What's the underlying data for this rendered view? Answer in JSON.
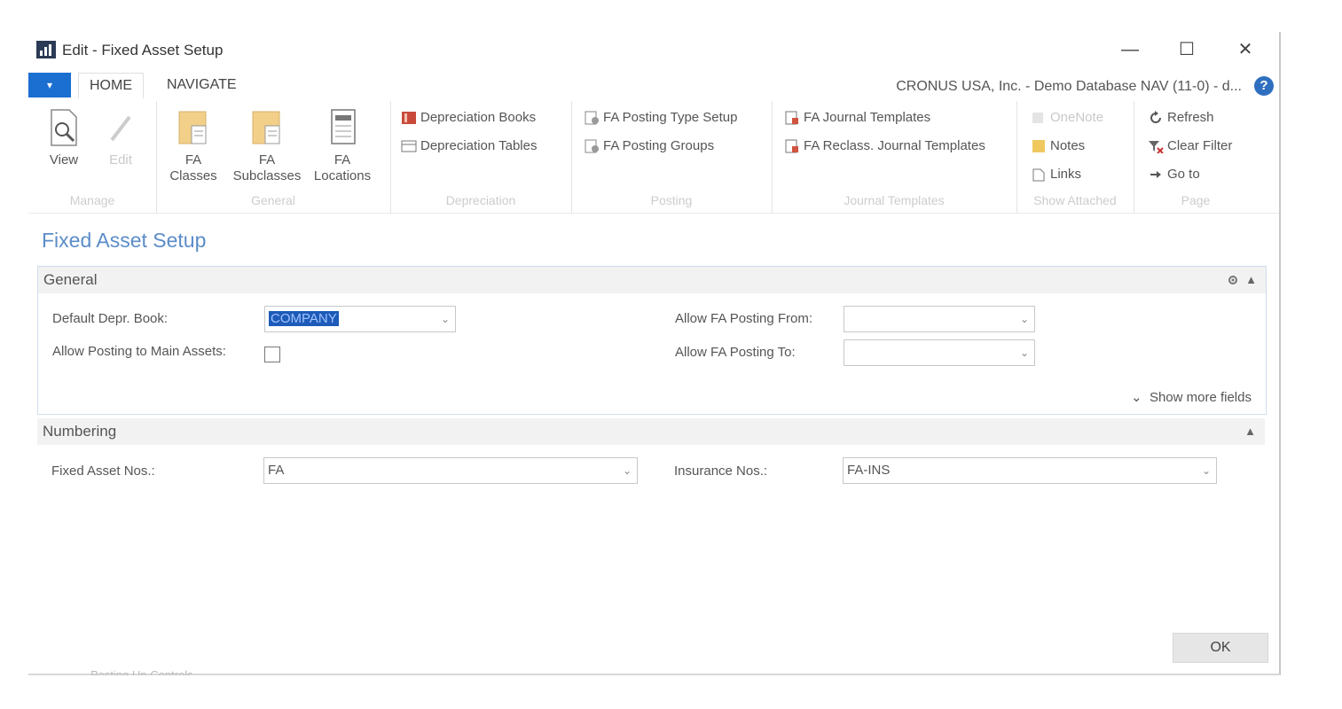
{
  "window": {
    "title": "Edit - Fixed Asset Setup",
    "minimize": "—",
    "maximize": "☐",
    "close": "✕"
  },
  "ribbon_tabs": {
    "file": "▾",
    "home": "HOME",
    "navigate": "NAVIGATE",
    "company": "CRONUS USA, Inc. - Demo Database NAV (11-0) - d...",
    "help": "?"
  },
  "ribbon": {
    "manage": {
      "label": "Manage",
      "view": "View",
      "edit": "Edit"
    },
    "general": {
      "label": "General",
      "classes_1": "FA",
      "classes_2": "Classes",
      "subclasses_1": "FA",
      "subclasses_2": "Subclasses",
      "locations_1": "FA",
      "locations_2": "Locations"
    },
    "depreciation": {
      "label": "Depreciation",
      "books": "Depreciation Books",
      "tables": "Depreciation Tables"
    },
    "posting": {
      "label": "Posting",
      "type_setup": "FA Posting Type Setup",
      "groups": "FA Posting Groups"
    },
    "journal": {
      "label": "Journal Templates",
      "templates": "FA Journal Templates",
      "reclass": "FA Reclass. Journal Templates"
    },
    "attached": {
      "label": "Show Attached",
      "onenote": "OneNote",
      "notes": "Notes",
      "links": "Links"
    },
    "page": {
      "label": "Page",
      "refresh": "Refresh",
      "clear_filter": "Clear Filter",
      "go_to": "Go to"
    }
  },
  "page": {
    "title": "Fixed Asset Setup"
  },
  "general": {
    "header": "General",
    "default_depr_book_label": "Default Depr. Book:",
    "default_depr_book_value": "COMPANY",
    "allow_main_assets_label": "Allow Posting to Main Assets:",
    "allow_main_assets_checked": false,
    "allow_from_label": "Allow FA Posting From:",
    "allow_from_value": "",
    "allow_to_label": "Allow FA Posting To:",
    "allow_to_value": "",
    "show_more": "Show more fields"
  },
  "numbering": {
    "header": "Numbering",
    "fa_nos_label": "Fixed Asset Nos.:",
    "fa_nos_value": "FA",
    "ins_nos_label": "Insurance Nos.:",
    "ins_nos_value": "FA-INS"
  },
  "ok_label": "OK",
  "footer_partial": "Posting Up Controls"
}
